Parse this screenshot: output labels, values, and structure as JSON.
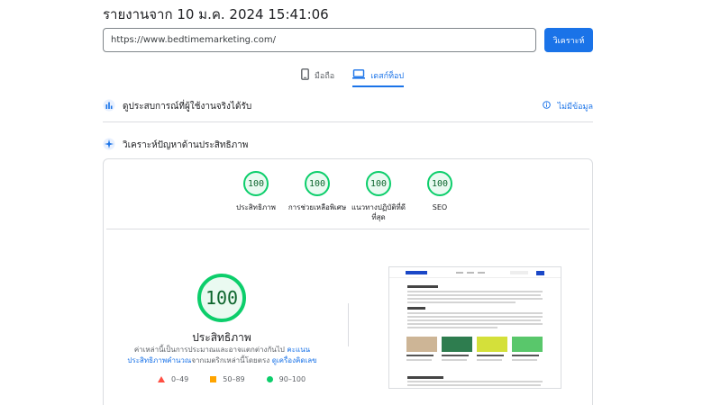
{
  "header": {
    "report_title": "รายงานจาก 10 ม.ค. 2024 15:41:06"
  },
  "search": {
    "url_value": "https://www.bedtimemarketing.com/",
    "analyze_label": "วิเคราะห์"
  },
  "device_tabs": [
    {
      "label": "มือถือ",
      "icon": "phone-icon",
      "active": false
    },
    {
      "label": "เดสก์ท็อป",
      "icon": "desktop-icon",
      "active": true
    }
  ],
  "field_data": {
    "title": "ดูประสบการณ์ที่ผู้ใช้งานจริงได้รับ",
    "no_data_label": "ไม่มีข้อมูล"
  },
  "diagnose": {
    "title": "วิเคราะห์ปัญหาด้านประสิทธิภาพ"
  },
  "scores": [
    {
      "value": "100",
      "label": "ประสิทธิภาพ"
    },
    {
      "value": "100",
      "label": "การช่วยเหลือพิเศษ"
    },
    {
      "value": "100",
      "label": "แนวทางปฏิบัติที่ดี\nที่สุด"
    },
    {
      "value": "100",
      "label": "SEO"
    }
  ],
  "performance": {
    "score": "100",
    "label": "ประสิทธิภาพ",
    "desc_prefix": "ค่าเหล่านี้เป็นการประมาณและอาจแตกต่างกันไป ",
    "desc_link1": "คะแนนประสิทธิภาพคำนวณ",
    "desc_middle": "จากเมตริกเหล่านี้โดยตรง ",
    "desc_link2": "ดูเครื่องคิดเลข"
  },
  "legend": [
    {
      "range": "0–49",
      "color": "#ff4e42"
    },
    {
      "range": "50–89",
      "color": "#ffa400"
    },
    {
      "range": "90–100",
      "color": "#0cce6b"
    }
  ],
  "colors": {
    "accent": "#1a73e8",
    "pass": "#0cce6b"
  }
}
